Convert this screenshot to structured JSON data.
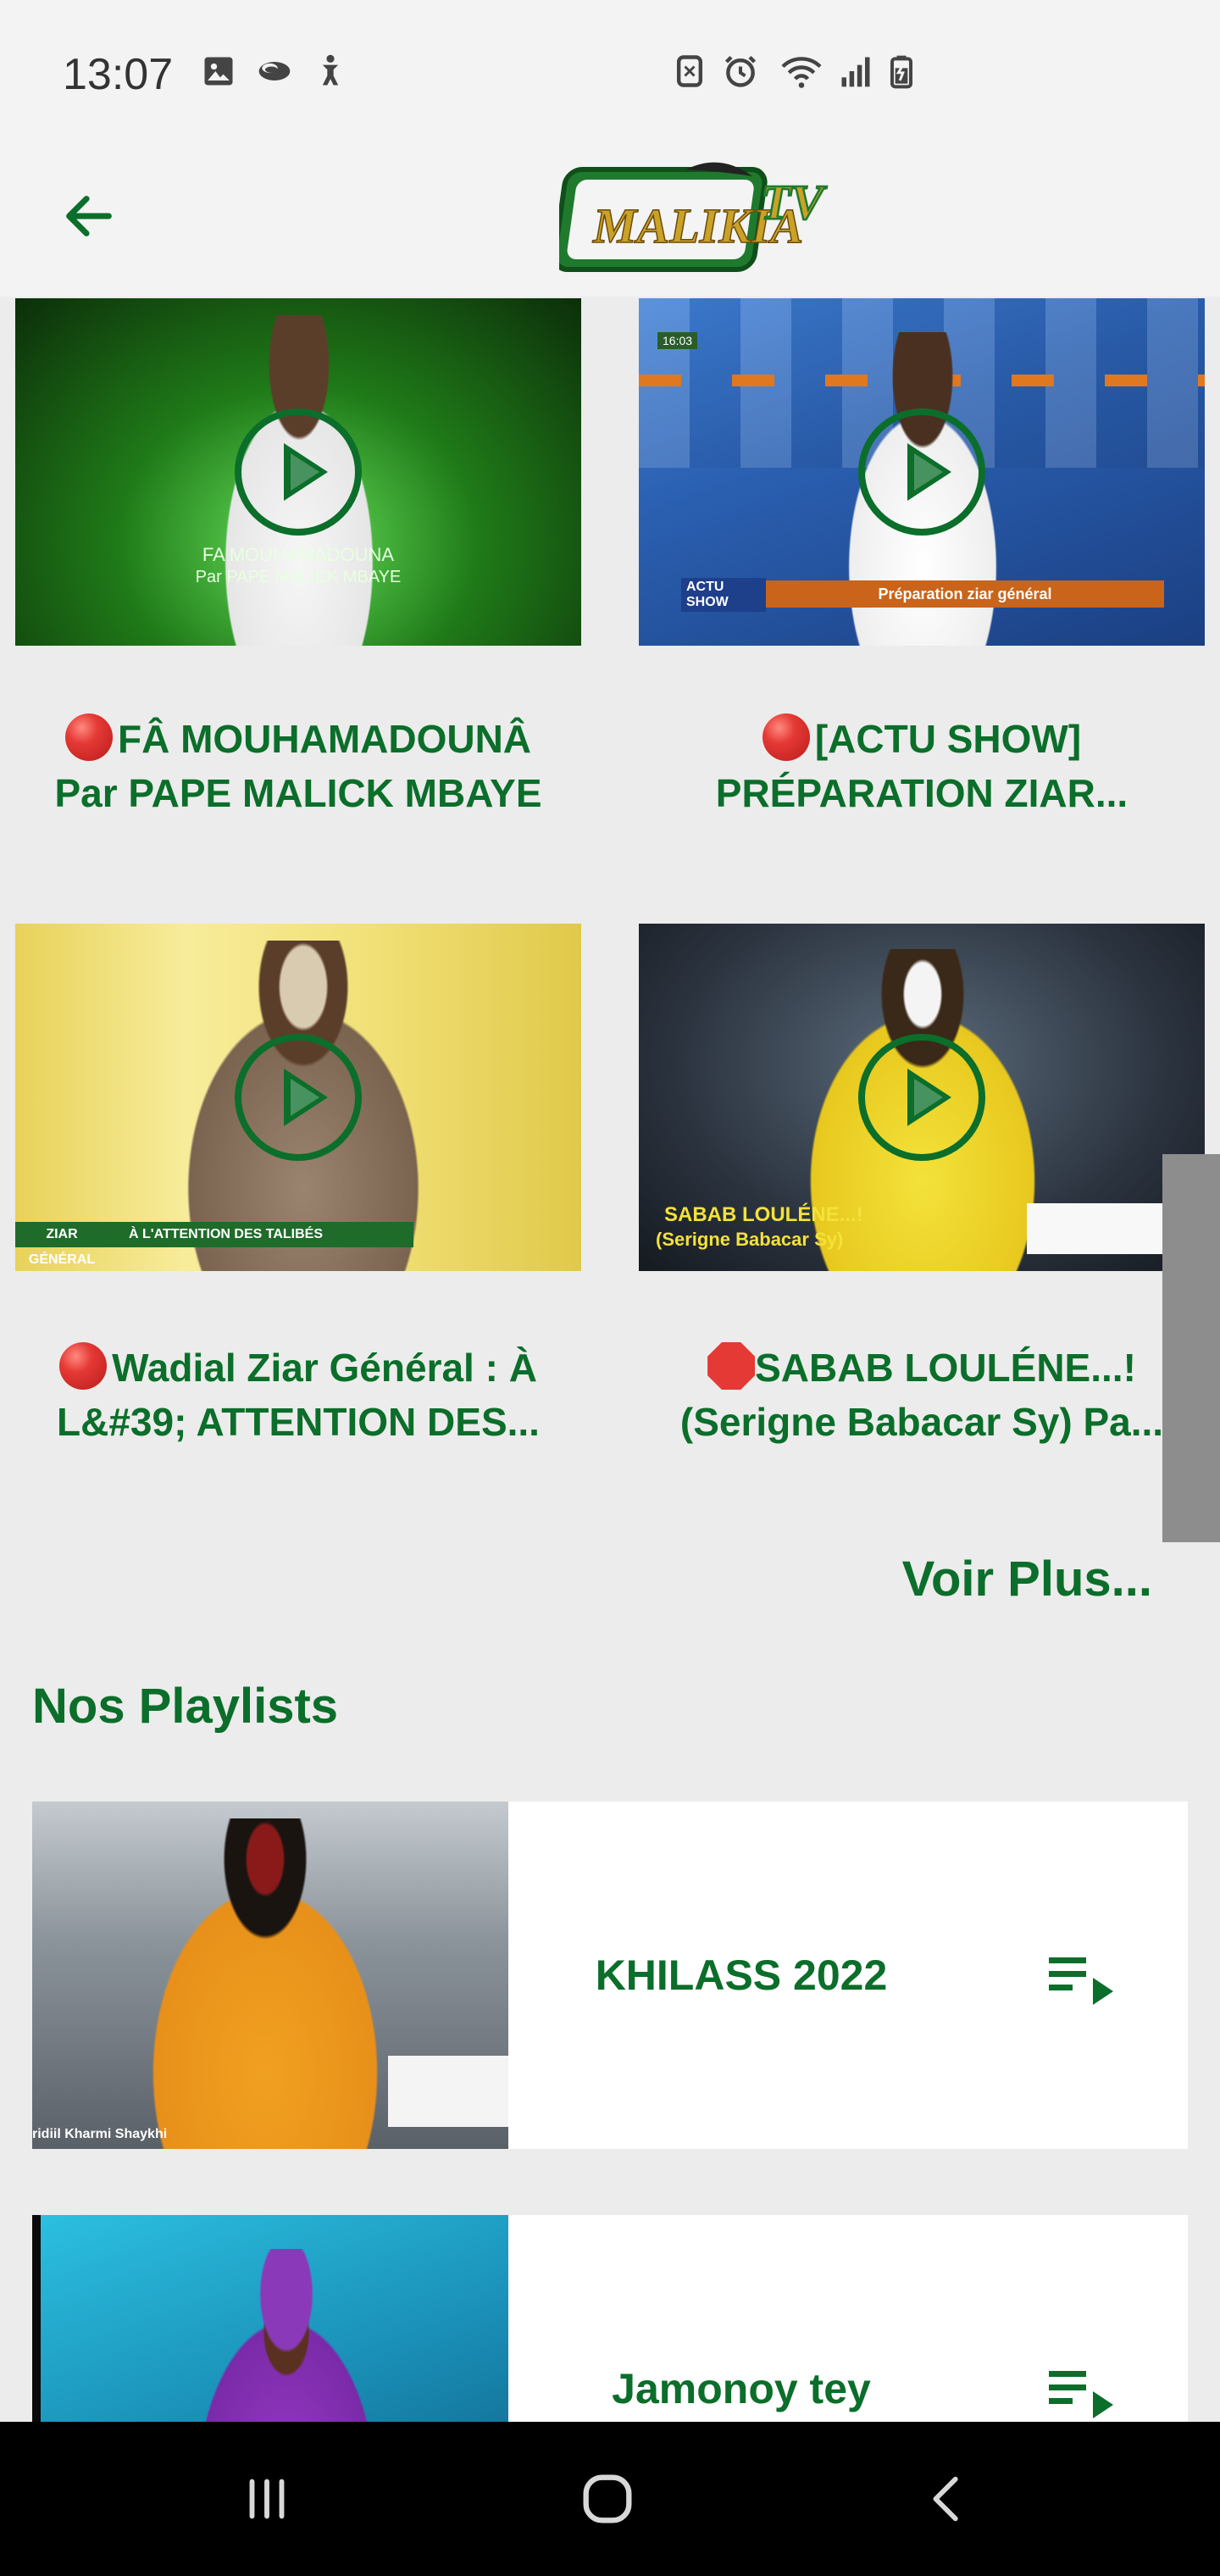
{
  "status_bar": {
    "time": "13:07",
    "left_icons": [
      "gallery-icon",
      "cloud-icon",
      "accessibility-icon"
    ],
    "right_icons": [
      "nfc-icon",
      "alarm-icon",
      "wifi-icon",
      "signal-icon",
      "battery-charging-icon"
    ]
  },
  "app_bar": {
    "back_icon": "arrow-left-icon",
    "logo_text_main": "MALIKIA",
    "logo_text_tv": "TV"
  },
  "videos": [
    {
      "prefix_icon": "red-circle-emoji",
      "title_line1": "FÂ MOUHAMADOUNÂ",
      "title_line2": "Par PAPE MALICK MBAYE",
      "thumb_caption_1": "FA MOUHAMADOUNA",
      "thumb_caption_2": "Par PAPE MALICK MBAYE"
    },
    {
      "prefix_icon": "red-circle-emoji",
      "title_line1": "[ACTU SHOW]",
      "title_line2": "PRÉPARATION ZIAR...",
      "thumb_band_left": "ACTU SHOW",
      "thumb_band_text": "Préparation ziar général",
      "thumb_clock": "16:03"
    },
    {
      "prefix_icon": "red-circle-emoji",
      "title_line1": "Wadial Ziar Général : À",
      "title_line2": "L&#39; ATTENTION DES...",
      "thumb_band_left": "ZIAR GÉNÉRAL",
      "thumb_band_text": "À L'ATTENTION DES TALIBÉS"
    },
    {
      "prefix_icon": "stop-sign-emoji",
      "title_line1": "SABAB LOULÉNE...!",
      "title_line2": "(Serigne Babacar Sy) Pa...",
      "thumb_caption_1": "SABAB LOULÉNE...!",
      "thumb_caption_2": "(Serigne Babacar Sy)"
    }
  ],
  "see_more": "Voir Plus...",
  "playlists_section": {
    "title": "Nos Playlists",
    "items": [
      {
        "title": "KHILASS 2022",
        "thumb_caption": "ridiil Kharmi Shaykhi",
        "icon": "playlist-play-icon"
      },
      {
        "title": "Jamonoy tey",
        "icon": "playlist-play-icon"
      }
    ]
  },
  "nav_bar": {
    "icons": [
      "recent-apps-icon",
      "home-icon",
      "back-icon"
    ]
  },
  "colors": {
    "accent": "#0b6e2a",
    "background": "#ececec",
    "bar_background": "#f3f3f3",
    "live_red": "#e53935"
  }
}
